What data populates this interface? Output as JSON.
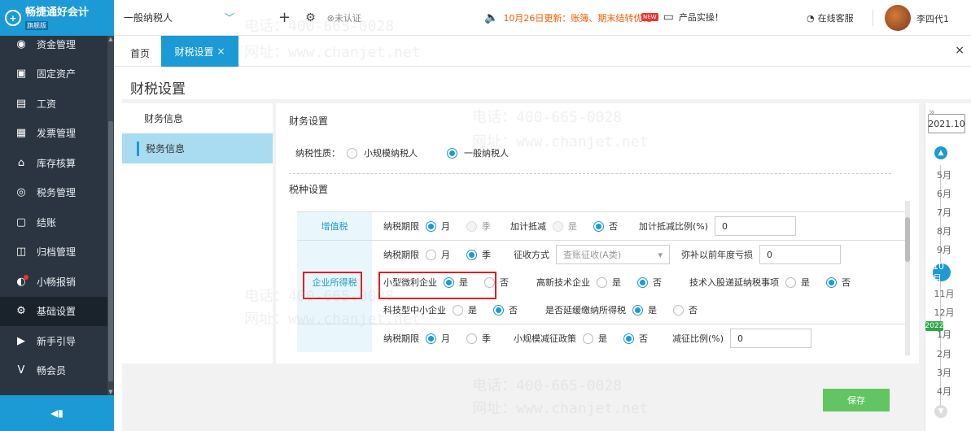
{
  "app": {
    "logo_text": "畅捷通好会计",
    "logo_sub": "旗舰版"
  },
  "sidebar": {
    "items": [
      {
        "label": "资金管理",
        "icon": "money-icon"
      },
      {
        "label": "固定资产",
        "icon": "asset-icon"
      },
      {
        "label": "工资",
        "icon": "salary-icon"
      },
      {
        "label": "发票管理",
        "icon": "invoice-icon"
      },
      {
        "label": "库存核算",
        "icon": "inventory-icon"
      },
      {
        "label": "税务管理",
        "icon": "tax-icon"
      },
      {
        "label": "结账",
        "icon": "checkout-icon"
      },
      {
        "label": "归档管理",
        "icon": "archive-icon"
      },
      {
        "label": "小畅报销",
        "icon": "reimburse-icon"
      },
      {
        "label": "基础设置",
        "icon": "settings-icon"
      },
      {
        "label": "新手引导",
        "icon": "guide-icon"
      },
      {
        "label": "畅会员",
        "icon": "vip-icon"
      }
    ],
    "active_index": 9
  },
  "topbar": {
    "tax_type": "一般纳税人",
    "cert_status": "未认证",
    "notice": "10月26日更新：账簿、期末结转优化",
    "new_badge": "NEW",
    "product_demo": "产品实操！",
    "online_service": "在线客服",
    "username": "李四代1"
  },
  "tabs": {
    "home": "首页",
    "active": "财税设置",
    "active_close": "×",
    "close_all": "×"
  },
  "page": {
    "title": "财税设置",
    "subnav": [
      "财务信息",
      "税务信息"
    ],
    "subnav_selected": 1
  },
  "finance": {
    "section_title": "财务设置",
    "nature_label": "纳税性质：",
    "nature_options": [
      "小规模纳税人",
      "一般纳税人"
    ],
    "nature_selected": "一般纳税人"
  },
  "tax": {
    "section_title": "税种设置",
    "vat": {
      "name": "增值税",
      "period_label": "纳税期限",
      "period_month": "月",
      "period_quarter": "季",
      "period_selected": "月",
      "extra_deduct_label": "加计抵减",
      "extra_deduct_yes": "是",
      "extra_deduct_no": "否",
      "extra_deduct_selected": "否",
      "ratio_label": "加计抵减比例(%)",
      "ratio_value": "0"
    },
    "cit": {
      "name": "企业所得税",
      "period_label": "纳税期限",
      "period_month": "月",
      "period_quarter": "季",
      "period_selected": "季",
      "method_label": "征收方式",
      "method_value": "查账征收(A类)",
      "loss_label": "弥补以前年度亏损",
      "loss_value": "0",
      "small_label": "小型微利企业",
      "small_yes": "是",
      "small_no": "否",
      "small_selected": "是",
      "hightech_label": "高新技术企业",
      "hightech_yes": "是",
      "hightech_no": "否",
      "hightech_selected": "否",
      "tech_defer_label": "技术入股递延纳税事项",
      "tech_defer_yes": "是",
      "tech_defer_no": "否",
      "tech_defer_selected": "否",
      "sme_label": "科技型中小企业",
      "sme_yes": "是",
      "sme_no": "否",
      "sme_selected": "否",
      "delay_label": "是否延缓缴纳所得税",
      "delay_yes": "是",
      "delay_no": "否",
      "delay_selected": "是"
    },
    "other": {
      "period_label": "纳税期限",
      "period_month": "月",
      "period_quarter": "季",
      "period_selected": "月",
      "policy_label": "小规模减征政策",
      "policy_yes": "是",
      "policy_no": "否",
      "policy_selected": "否",
      "reduce_label": "减征比例(%)",
      "reduce_value": "0"
    }
  },
  "save_label": "保存",
  "datepanel": {
    "year": "2021.10",
    "months_2021": [
      "5月",
      "6月",
      "7月",
      "8月",
      "9月"
    ],
    "current_month": "10月",
    "months_after": [
      "11月",
      "12月"
    ],
    "next_year": "2022",
    "months_2022": [
      "1月",
      "2月",
      "3月",
      "4月"
    ]
  },
  "watermark": {
    "phone": "电话：400-665-0028",
    "site": "网址：www.chanjet.net"
  },
  "colors": {
    "brand": "#1b9ad6",
    "sidebar": "#2b3541",
    "save": "#62c462",
    "highlight": "#e02020"
  }
}
